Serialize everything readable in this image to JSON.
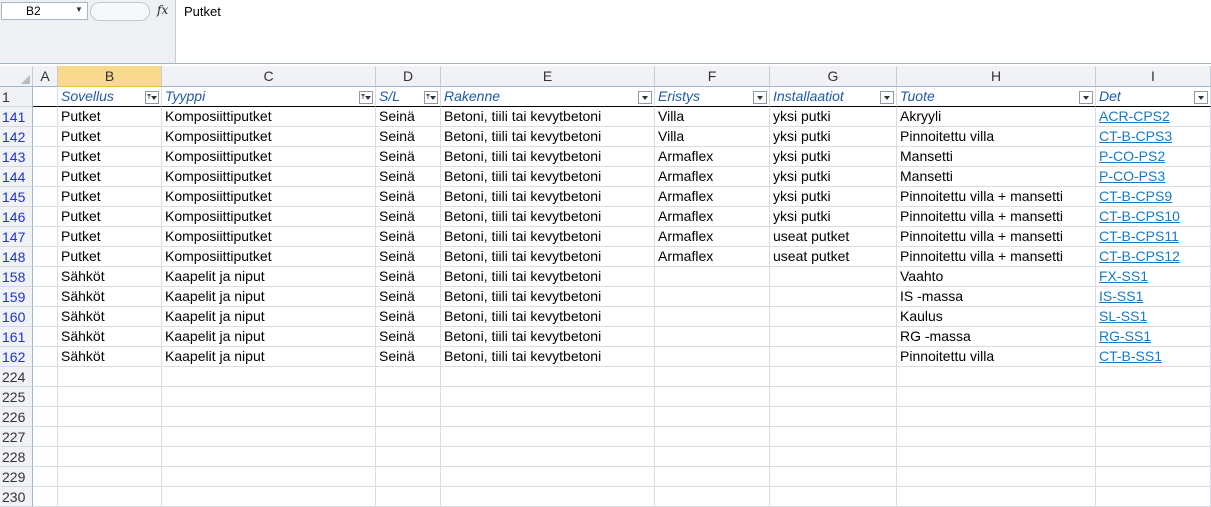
{
  "formula_bar": {
    "name_box": "B2",
    "fx_label": "fx",
    "formula": "Putket"
  },
  "columns": [
    "A",
    "B",
    "C",
    "D",
    "E",
    "F",
    "G",
    "H",
    "I"
  ],
  "selected_column": "B",
  "header_row": {
    "row_number": "1",
    "cells": [
      "",
      "Sovellus",
      "Tyyppi",
      "S/L",
      "Rakenne",
      "Eristys",
      "Installaatiot",
      "Tuote",
      "Det"
    ],
    "filter_active": [
      false,
      true,
      true,
      true,
      false,
      false,
      false,
      false,
      false
    ]
  },
  "rows": [
    {
      "n": "141",
      "cells": [
        "",
        "Putket",
        "Komposiittiputket",
        "Seinä",
        "Betoni, tiili tai kevytbetoni",
        "Villa",
        "yksi putki",
        "Akryyli",
        "ACR-CPS2"
      ]
    },
    {
      "n": "142",
      "cells": [
        "",
        "Putket",
        "Komposiittiputket",
        "Seinä",
        "Betoni, tiili tai kevytbetoni",
        "Villa",
        "yksi putki",
        "Pinnoitettu villa",
        "CT-B-CPS3"
      ]
    },
    {
      "n": "143",
      "cells": [
        "",
        "Putket",
        "Komposiittiputket",
        "Seinä",
        "Betoni, tiili tai kevytbetoni",
        "Armaflex",
        "yksi putki",
        "Mansetti",
        "P-CO-PS2"
      ]
    },
    {
      "n": "144",
      "cells": [
        "",
        "Putket",
        "Komposiittiputket",
        "Seinä",
        "Betoni, tiili tai kevytbetoni",
        "Armaflex",
        "yksi putki",
        "Mansetti",
        "P-CO-PS3"
      ]
    },
    {
      "n": "145",
      "cells": [
        "",
        "Putket",
        "Komposiittiputket",
        "Seinä",
        "Betoni, tiili tai kevytbetoni",
        "Armaflex",
        "yksi putki",
        "Pinnoitettu villa + mansetti",
        "CT-B-CPS9"
      ]
    },
    {
      "n": "146",
      "cells": [
        "",
        "Putket",
        "Komposiittiputket",
        "Seinä",
        "Betoni, tiili tai kevytbetoni",
        "Armaflex",
        "yksi putki",
        "Pinnoitettu villa + mansetti",
        "CT-B-CPS10"
      ]
    },
    {
      "n": "147",
      "cells": [
        "",
        "Putket",
        "Komposiittiputket",
        "Seinä",
        "Betoni, tiili tai kevytbetoni",
        "Armaflex",
        "useat putket",
        "Pinnoitettu villa + mansetti",
        "CT-B-CPS11"
      ]
    },
    {
      "n": "148",
      "cells": [
        "",
        "Putket",
        "Komposiittiputket",
        "Seinä",
        "Betoni, tiili tai kevytbetoni",
        "Armaflex",
        "useat putket",
        "Pinnoitettu villa + mansetti",
        "CT-B-CPS12"
      ]
    },
    {
      "n": "158",
      "cells": [
        "",
        "Sähköt",
        "Kaapelit ja niput",
        "Seinä",
        "Betoni, tiili tai kevytbetoni",
        "",
        "",
        "Vaahto",
        "FX-SS1"
      ]
    },
    {
      "n": "159",
      "cells": [
        "",
        "Sähköt",
        "Kaapelit ja niput",
        "Seinä",
        "Betoni, tiili tai kevytbetoni",
        "",
        "",
        "IS -massa",
        "IS-SS1"
      ]
    },
    {
      "n": "160",
      "cells": [
        "",
        "Sähköt",
        "Kaapelit ja niput",
        "Seinä",
        "Betoni, tiili tai kevytbetoni",
        "",
        "",
        "Kaulus",
        "SL-SS1"
      ]
    },
    {
      "n": "161",
      "cells": [
        "",
        "Sähköt",
        "Kaapelit ja niput",
        "Seinä",
        "Betoni, tiili tai kevytbetoni",
        "",
        "",
        "RG -massa",
        "RG-SS1"
      ]
    },
    {
      "n": "162",
      "cells": [
        "",
        "Sähköt",
        "Kaapelit ja niput",
        "Seinä",
        "Betoni, tiili tai kevytbetoni",
        "",
        "",
        "Pinnoitettu villa",
        "CT-B-SS1"
      ]
    }
  ],
  "empty_rows": [
    "224",
    "225",
    "226",
    "227",
    "228",
    "229",
    "230"
  ]
}
